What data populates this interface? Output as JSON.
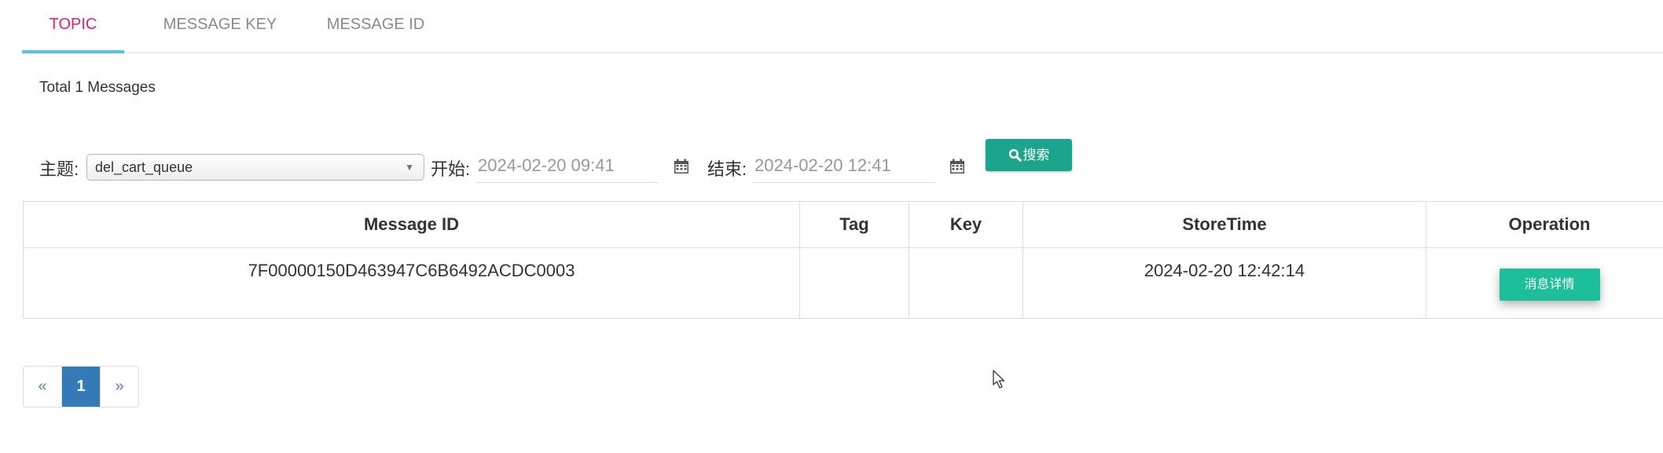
{
  "tabs": [
    {
      "label": "TOPIC",
      "active": true
    },
    {
      "label": "MESSAGE KEY",
      "active": false
    },
    {
      "label": "MESSAGE ID",
      "active": false
    }
  ],
  "summary": {
    "total": "Total 1 Messages"
  },
  "filters": {
    "topic_label": "主题:",
    "topic_value": "del_cart_queue",
    "start_label": "开始:",
    "start_value": "2024-02-20 09:41",
    "end_label": "结束:",
    "end_value": "2024-02-20 12:41",
    "search_label": "搜索"
  },
  "table": {
    "headers": [
      "Message ID",
      "Tag",
      "Key",
      "StoreTime",
      "Operation"
    ],
    "rows": [
      {
        "message_id": "7F00000150D463947C6B6492ACDC0003",
        "tag": "",
        "key": "",
        "store_time": "2024-02-20 12:42:14",
        "operation_label": "消息详情"
      }
    ]
  },
  "pagination": {
    "prev": "«",
    "current": "1",
    "next": "»"
  },
  "colors": {
    "accent": "#1ca58d",
    "active_tab": "#d6246e",
    "tab_indicator": "#5bc0de",
    "page_current": "#337ab7"
  },
  "icons": [
    "calendar-icon",
    "search-icon",
    "chevron-down-icon",
    "mouse-cursor-icon"
  ]
}
